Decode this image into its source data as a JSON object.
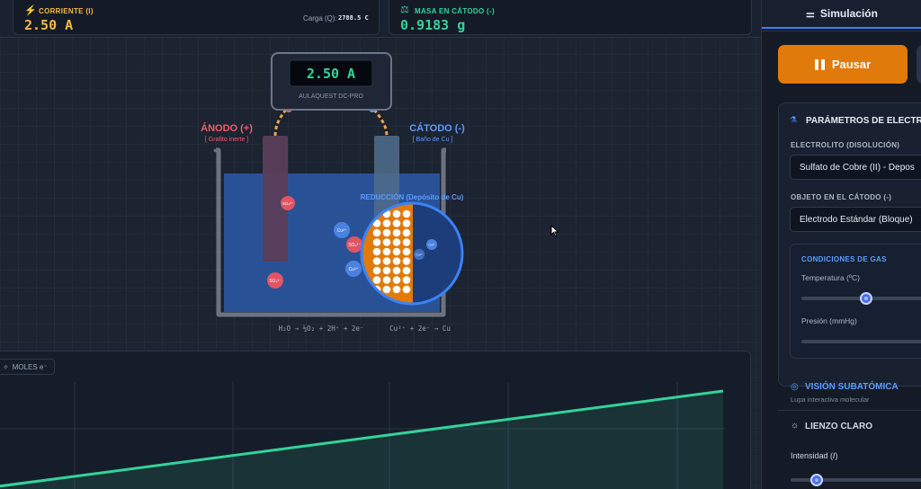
{
  "header": {
    "current": {
      "title": "CORRIENTE (I)",
      "value": "2.50 A",
      "charge_label": "Carga (Q):",
      "charge_value": "2788.5 C"
    },
    "mass": {
      "title": "MASA EN CÁTODO (-)",
      "value": "0.9183 g"
    }
  },
  "apparatus": {
    "meter_value": "2.50 A",
    "meter_brand": "AULAQUEST DC-PRO",
    "anode_title": "ÁNODO (+)",
    "anode_sub": "[ Grafito inerte ]",
    "cathode_title": "CÁTODO (-)",
    "cathode_sub": "[ Baño de Cu ]",
    "zoom_label": "REDUCCIÓN (Depósito de Cu)",
    "anode_eq": "H₂O → ½O₂ + 2H⁺ + 2e⁻",
    "cathode_eq": "Cu²⁺ + 2e⁻ → Cu",
    "ion_cu": "Cu²⁺",
    "ion_so4": "SO₄²⁻"
  },
  "chart": {
    "tab_label": "MOLES e⁻"
  },
  "chart_data": {
    "type": "line",
    "title": "",
    "xlabel": "",
    "ylabel": "",
    "series": [
      {
        "values": [
          0.0,
          1.0
        ]
      }
    ],
    "x": [
      0,
      1
    ]
  },
  "sidebar": {
    "tab_label": "Simulación",
    "pause_label": "Pausar",
    "params_title": "PARÁMETROS DE ELECTRO",
    "electrolyte_label": "ELECTROLITO (DISOLUCIÓN)",
    "electrolyte_value": "Sulfato de Cobre (II) - Depos",
    "cathode_object_label": "OBJETO EN EL CÁTODO (-)",
    "cathode_object_value": "Electrodo Estándar (Bloque)",
    "gas_title": "CONDICIONES DE GAS",
    "temperature_label": "Temperatura (ºC)",
    "temperature_level": 0.48,
    "pressure_label": "Presión (mmHg)",
    "subatomic_title": "VISIÓN SUBATÓMICA",
    "subatomic_sub": "Lupa interactiva molecular",
    "light_title": "LIENZO CLARO",
    "intensity_label": "Intensidad (𝐼)",
    "intensity_level": 0.2
  },
  "colors": {
    "accent": "#e07a0b",
    "blue": "#3b82f6",
    "green": "#34d399",
    "anode": "#f25c6b",
    "cathode": "#5b9cff"
  }
}
